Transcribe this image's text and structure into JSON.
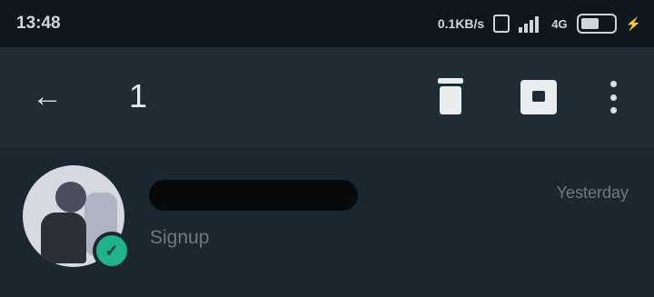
{
  "status_bar": {
    "time": "13:48",
    "network_speed": "0.1KB/s",
    "network_type": "4G",
    "battery_level": 0.55,
    "icons": [
      "vibrate-icon",
      "signal-icon",
      "battery-icon",
      "charging-icon"
    ]
  },
  "selection_bar": {
    "selected_count": "1",
    "icons": [
      "back-arrow-icon",
      "trash-icon",
      "archive-icon",
      "more-vert-icon"
    ]
  },
  "chat": {
    "contact_name": "",
    "last_message": "Signup",
    "timestamp": "Yesterday",
    "selected": true
  },
  "colors": {
    "app_bar": "#1f2c34",
    "background": "#121b22",
    "selected_badge": "#21b18b"
  }
}
